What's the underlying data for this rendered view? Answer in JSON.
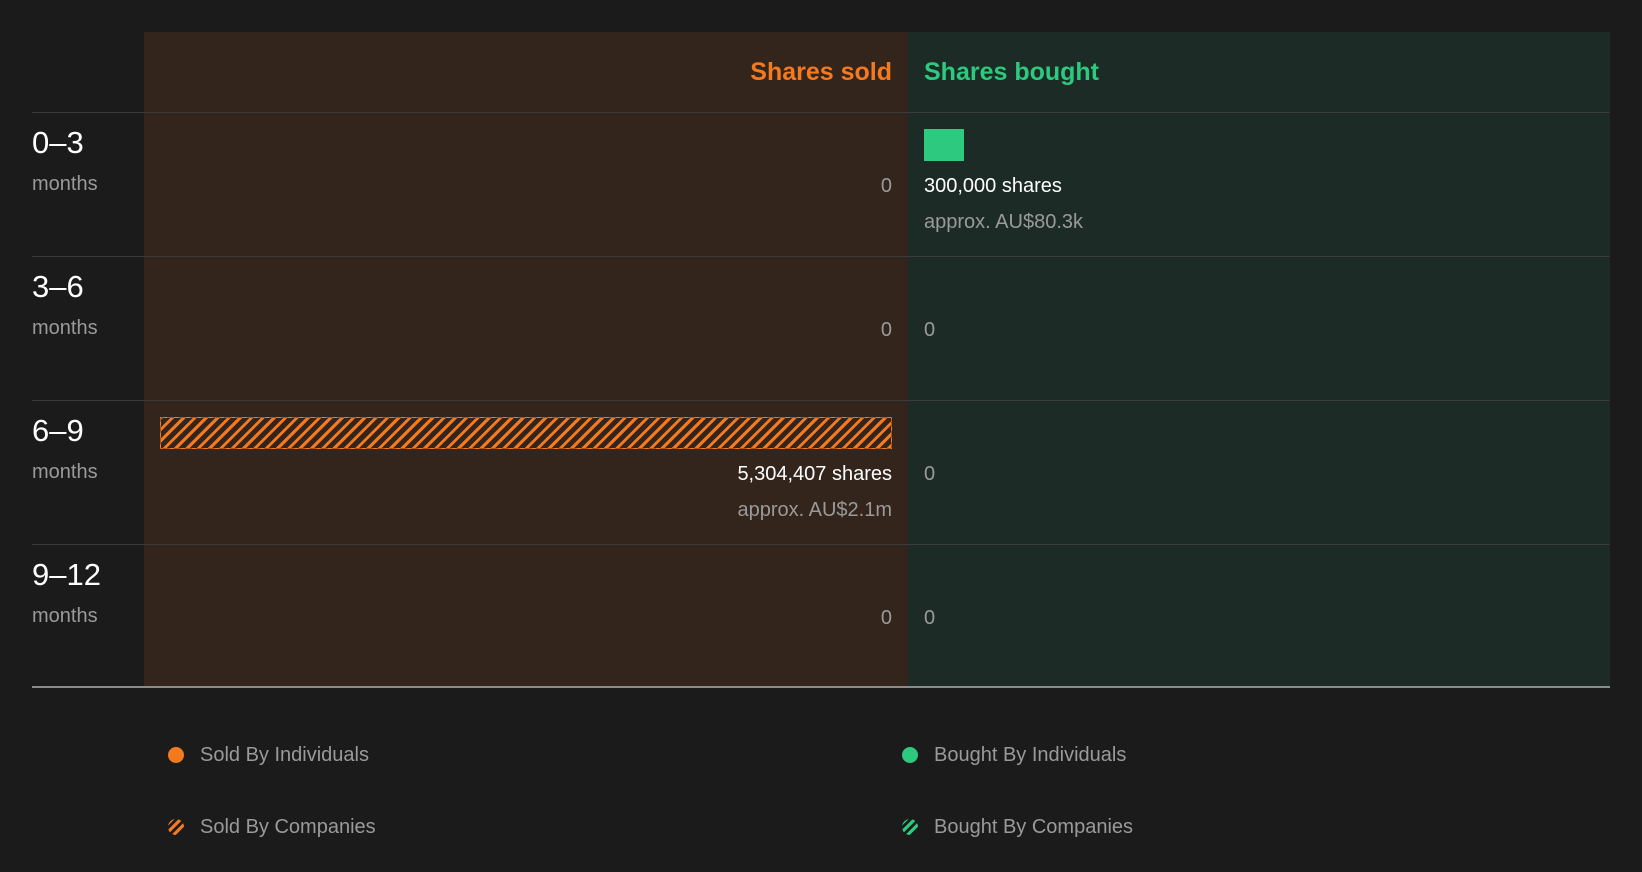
{
  "chart_data": {
    "type": "bar",
    "sold_header": "Shares sold",
    "bought_header": "Shares bought",
    "rows": [
      {
        "range": "0–3",
        "unit": "months",
        "sold": {
          "total_label": "0",
          "individuals": 0,
          "companies": 0,
          "shares_text": "",
          "approx_text": ""
        },
        "bought": {
          "total_label": "",
          "individuals": 300000,
          "companies": 0,
          "shares_text": "300,000 shares",
          "approx_text": "approx. AU$80.3k"
        }
      },
      {
        "range": "3–6",
        "unit": "months",
        "sold": {
          "total_label": "0",
          "individuals": 0,
          "companies": 0,
          "shares_text": "",
          "approx_text": ""
        },
        "bought": {
          "total_label": "0",
          "individuals": 0,
          "companies": 0,
          "shares_text": "",
          "approx_text": ""
        }
      },
      {
        "range": "6–9",
        "unit": "months",
        "sold": {
          "total_label": "",
          "individuals": 0,
          "companies": 5304407,
          "shares_text": "5,304,407 shares",
          "approx_text": "approx. AU$2.1m"
        },
        "bought": {
          "total_label": "0",
          "individuals": 0,
          "companies": 0,
          "shares_text": "",
          "approx_text": ""
        }
      },
      {
        "range": "9–12",
        "unit": "months",
        "sold": {
          "total_label": "0",
          "individuals": 0,
          "companies": 0,
          "shares_text": "",
          "approx_text": ""
        },
        "bought": {
          "total_label": "0",
          "individuals": 0,
          "companies": 0,
          "shares_text": "",
          "approx_text": ""
        }
      }
    ],
    "max_value": 5304407,
    "legend": {
      "sold_individuals": "Sold By Individuals",
      "sold_companies": "Sold By Companies",
      "bought_individuals": "Bought By Individuals",
      "bought_companies": "Bought By Companies"
    },
    "colors": {
      "sold": "#f47a20",
      "bought": "#2dc97e",
      "sold_bg": "#33241c",
      "bought_bg": "#1c2b25"
    }
  }
}
